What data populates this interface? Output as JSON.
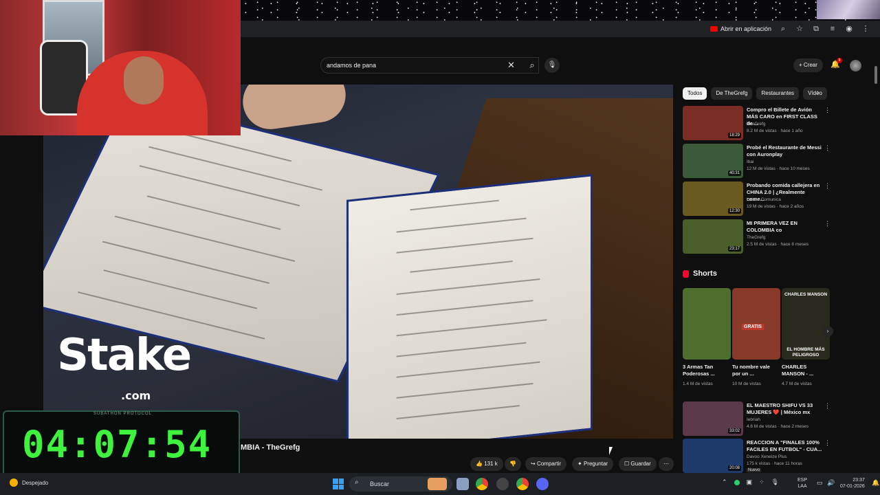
{
  "browser": {
    "open_in_app": "Abrir en aplicación"
  },
  "search": {
    "value": "andamos de pana"
  },
  "header": {
    "create_label": "Crear",
    "notif_count": "9"
  },
  "overlay": {
    "timer_label": "SUBATHON PROTOCOL",
    "timer": "04:07:54",
    "sponsor": "Stake",
    "sponsor_domain": ".com"
  },
  "video": {
    "title": "MBIA - TheGrefg",
    "likes": "131 k",
    "share": "Compartir",
    "ask": "Preguntar",
    "save": "Guardar"
  },
  "chips": [
    "Todos",
    "De TheGrefg",
    "Restaurantes",
    "Vídeo"
  ],
  "recommendations": [
    {
      "title": "Compro el Billete de Avión MÁS CARO en FIRST CLASS de ...",
      "channel": "TheGrefg",
      "meta": "8.2 M de vistas · hace 1 año",
      "duration": "18:29",
      "thumb_color": "#7a2d24"
    },
    {
      "title": "Probé el Restaurante de Messi con Auronplay",
      "channel": "Ibai",
      "meta": "12 M de vistas · hace 10 meses",
      "duration": "40:31",
      "thumb_color": "#3a5a3a"
    },
    {
      "title": "Probando comida callejera en CHINA 2.0 | ¿Realmente come...",
      "channel": "Luisito Comunica",
      "meta": "19 M de vistas · hace 2 años",
      "duration": "12:30",
      "thumb_color": "#6b5a20"
    },
    {
      "title": "MI PRIMERA VEZ EN COLOMBIA co",
      "channel": "TheGrefg",
      "meta": "2.5 M de vistas · hace 8 meses",
      "duration": "23:17",
      "thumb_color": "#4a5e2a"
    },
    {
      "title": "EL MAESTRO SHIFU VS 33 MUJERES ❤️ | México mx",
      "channel": "Iebriah",
      "meta": "4.6 M de vistas · hace 2 meses",
      "duration": "33:02",
      "thumb_color": "#5a3a4a"
    },
    {
      "title": "REACCION A \"FINALES 100% FACILES EN FUTBOL\" - CUA...",
      "channel": "Davoo Xeneize Plus",
      "meta": "175 k vistas · hace 11 horas",
      "duration": "20:08",
      "thumb_color": "#1e3a6a",
      "badge": "Nuevo"
    }
  ],
  "shorts": {
    "heading": "Shorts",
    "items": [
      {
        "title": "3 Armas Tan Poderosas ...",
        "views": "1.4 M de vistas",
        "thumb_color": "#4e6e2e"
      },
      {
        "title": "Tu nombre vale por un ...",
        "views": "10 M de vistas",
        "thumb_color": "#8a3a2a",
        "overlay": "GRATIS"
      },
      {
        "title": "CHARLES MANSON - ...",
        "views": "4.7 M de vistas",
        "thumb_color": "#2a2a1e",
        "top_text": "CHARLES MANSON",
        "bottom_text": "EL HOMBRE MÁS PELIGROSO"
      }
    ]
  },
  "taskbar": {
    "weather": "Despejado",
    "search_placeholder": "Buscar",
    "lang1": "ESP",
    "lang2": "LAA",
    "time": "23:37",
    "date": "07-01-2026"
  }
}
